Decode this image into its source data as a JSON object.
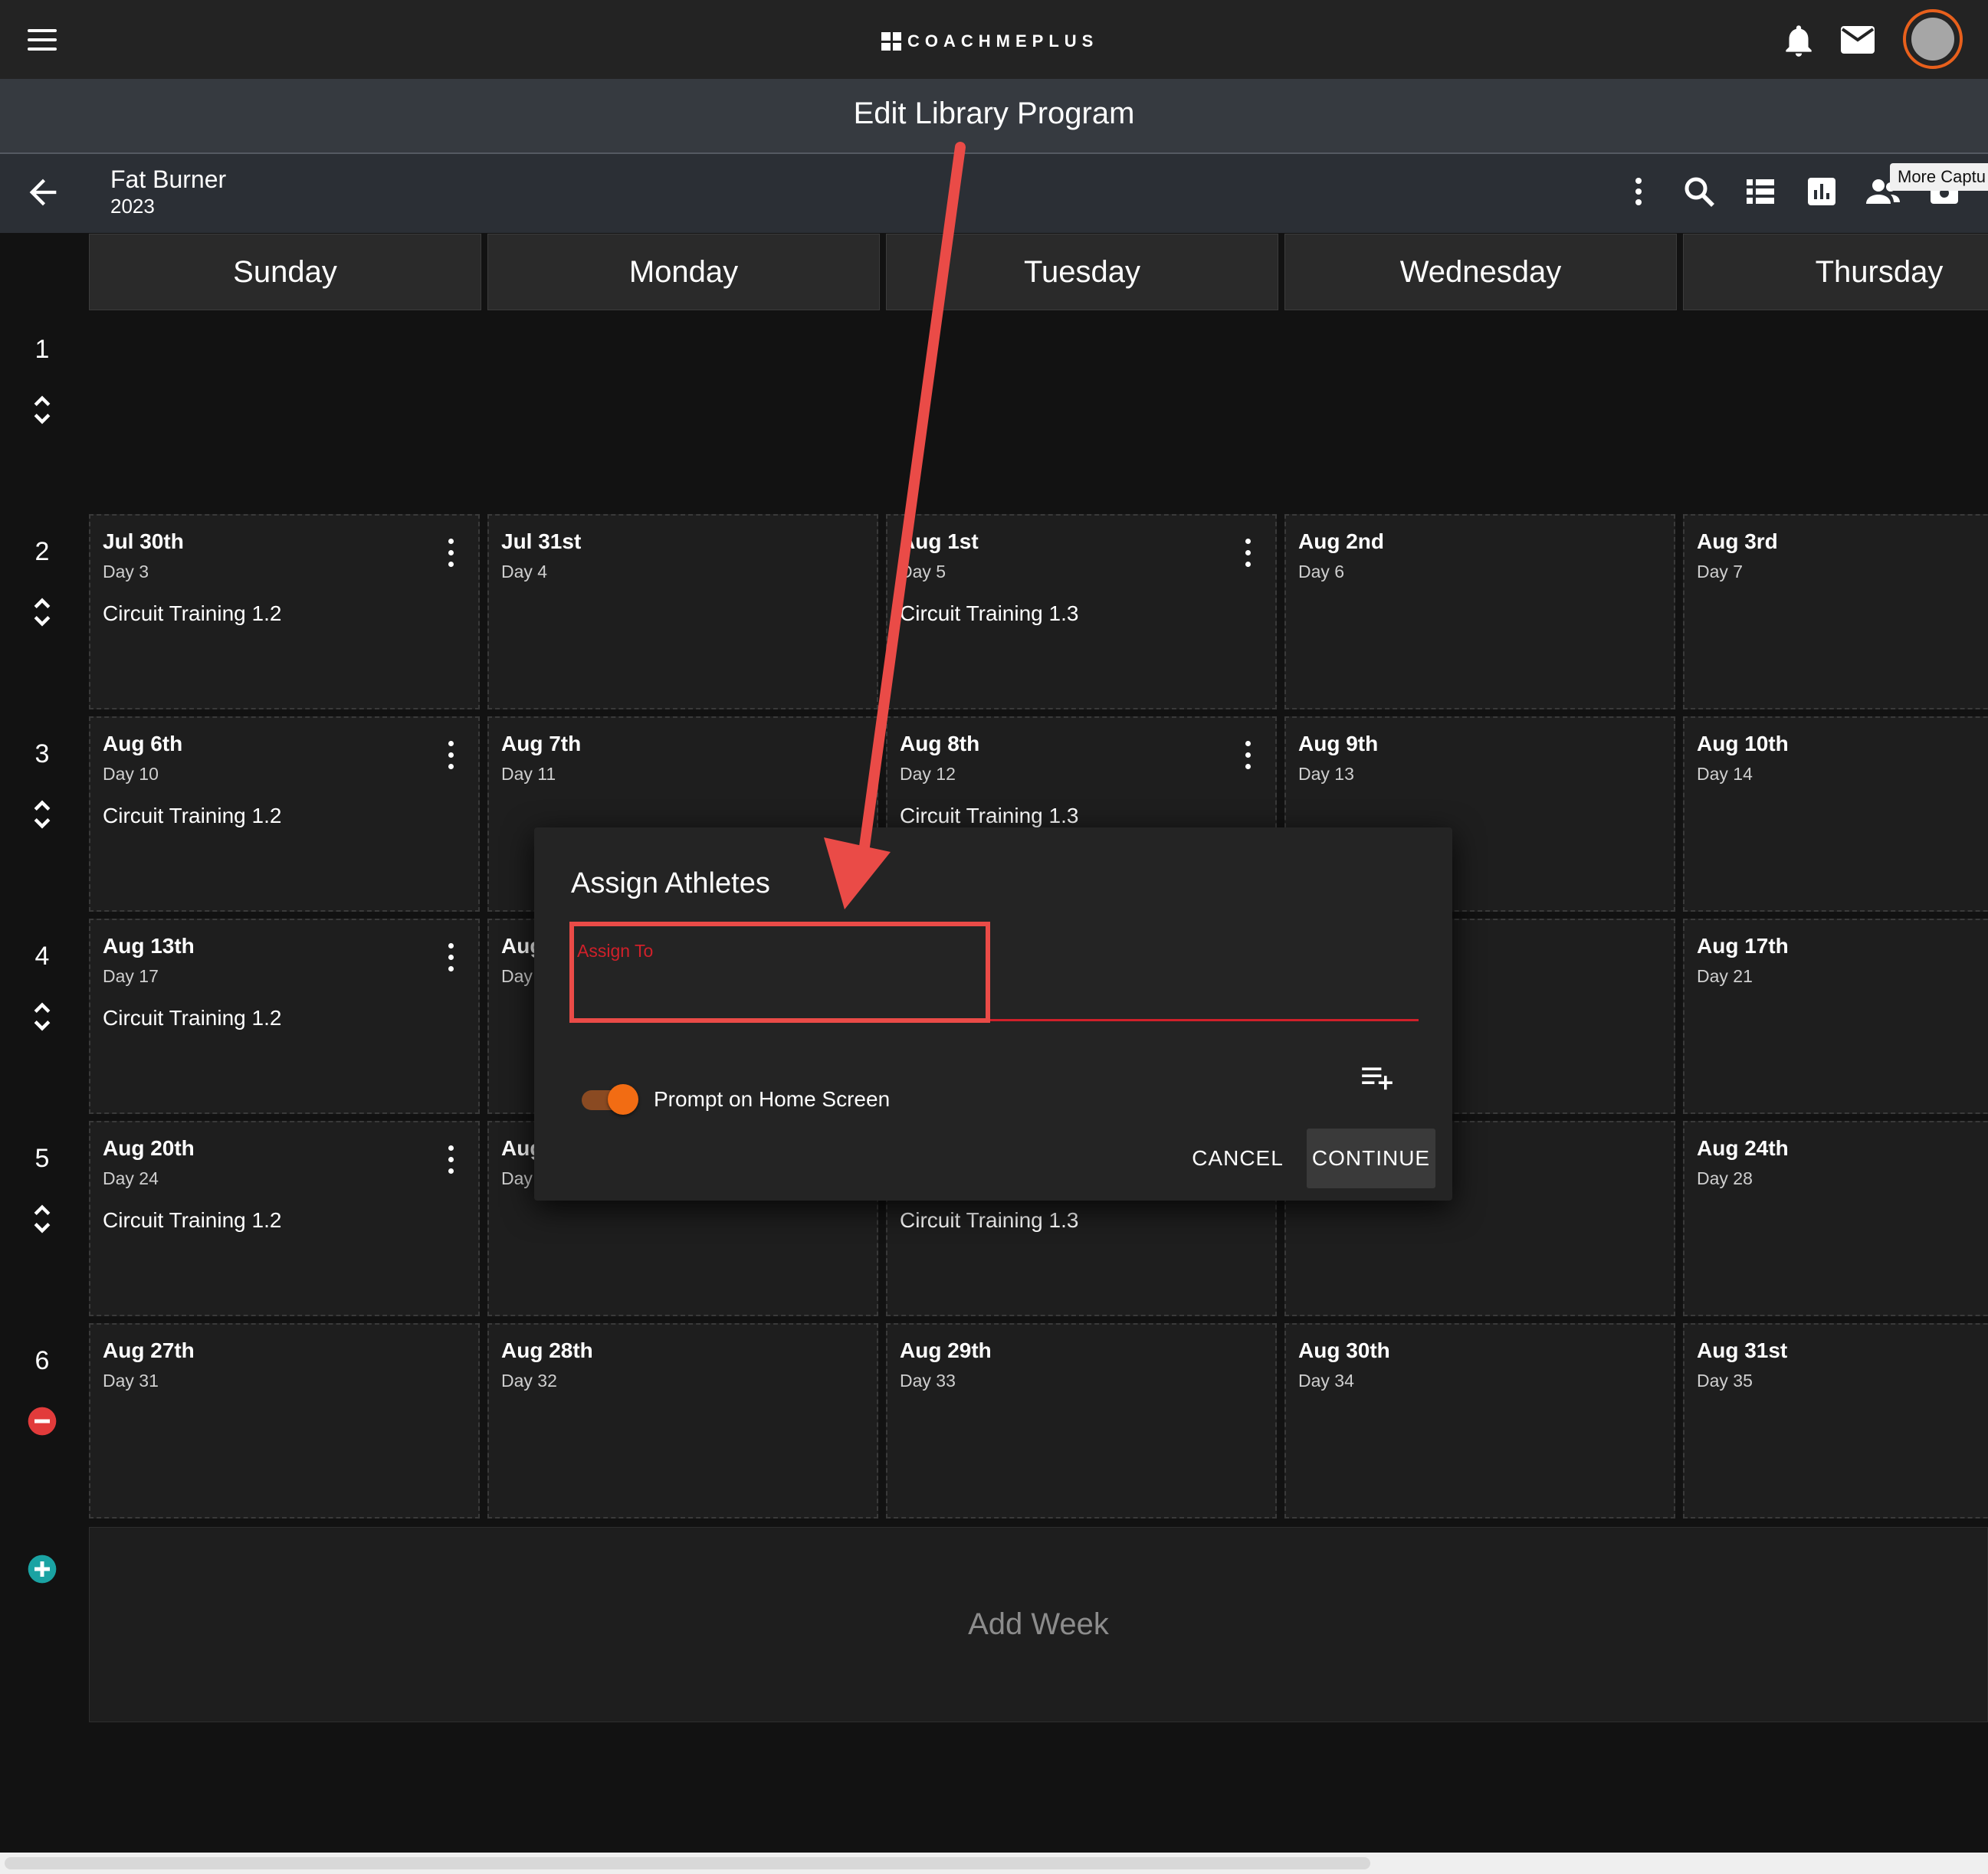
{
  "header": {
    "brand": "COACHMEPLUS",
    "page_title": "Edit Library Program"
  },
  "program": {
    "name": "Fat Burner",
    "year": "2023"
  },
  "toolbar": {
    "tooltip": "More Captu"
  },
  "days": [
    "Sunday",
    "Monday",
    "Tuesday",
    "Wednesday",
    "Thursday"
  ],
  "weeks": [
    {
      "number": "1",
      "cells": []
    },
    {
      "number": "2",
      "cells": [
        {
          "date": "Jul 30th",
          "day": "Day 3",
          "workout": "Circuit Training 1.2",
          "menu": true
        },
        {
          "date": "Jul 31st",
          "day": "Day 4",
          "workout": "",
          "menu": false
        },
        {
          "date": "Aug 1st",
          "day": "Day 5",
          "workout": "Circuit Training 1.3",
          "menu": true
        },
        {
          "date": "Aug 2nd",
          "day": "Day 6",
          "workout": "",
          "menu": false
        },
        {
          "date": "Aug 3rd",
          "day": "Day 7",
          "workout": "",
          "menu": false
        }
      ]
    },
    {
      "number": "3",
      "cells": [
        {
          "date": "Aug 6th",
          "day": "Day 10",
          "workout": "Circuit Training 1.2",
          "menu": true
        },
        {
          "date": "Aug 7th",
          "day": "Day 11",
          "workout": "",
          "menu": false
        },
        {
          "date": "Aug 8th",
          "day": "Day 12",
          "workout": "Circuit Training 1.3",
          "menu": true
        },
        {
          "date": "Aug 9th",
          "day": "Day 13",
          "workout": "",
          "menu": false
        },
        {
          "date": "Aug 10th",
          "day": "Day 14",
          "workout": "",
          "menu": false
        }
      ]
    },
    {
      "number": "4",
      "cells": [
        {
          "date": "Aug 13th",
          "day": "Day 17",
          "workout": "Circuit Training 1.2",
          "menu": true
        },
        {
          "date": "Aug",
          "day": "Day",
          "workout": "",
          "menu": false
        },
        {
          "date": "",
          "day": "",
          "workout": "",
          "menu": false
        },
        {
          "date": "",
          "day": "",
          "workout": "",
          "menu": false
        },
        {
          "date": "Aug 17th",
          "day": "Day 21",
          "workout": "",
          "menu": false
        }
      ]
    },
    {
      "number": "5",
      "cells": [
        {
          "date": "Aug 20th",
          "day": "Day 24",
          "workout": "Circuit Training 1.2",
          "menu": true
        },
        {
          "date": "Aug",
          "day": "Day",
          "workout": "",
          "menu": false
        },
        {
          "date": "",
          "day": "",
          "workout": "Circuit Training 1.3",
          "menu": false
        },
        {
          "date": "",
          "day": "",
          "workout": "",
          "menu": false
        },
        {
          "date": "Aug 24th",
          "day": "Day 28",
          "workout": "",
          "menu": false
        }
      ]
    },
    {
      "number": "6",
      "cells": [
        {
          "date": "Aug 27th",
          "day": "Day 31",
          "workout": "",
          "menu": false
        },
        {
          "date": "Aug 28th",
          "day": "Day 32",
          "workout": "",
          "menu": false
        },
        {
          "date": "Aug 29th",
          "day": "Day 33",
          "workout": "",
          "menu": false
        },
        {
          "date": "Aug 30th",
          "day": "Day 34",
          "workout": "",
          "menu": false
        },
        {
          "date": "Aug 31st",
          "day": "Day 35",
          "workout": "",
          "menu": false
        }
      ]
    }
  ],
  "add_week_label": "Add Week",
  "dialog": {
    "title": "Assign Athletes",
    "field_label": "Assign To",
    "toggle_label": "Prompt on Home Screen",
    "toggle_on": true,
    "cancel_label": "CANCEL",
    "continue_label": "CONTINUE"
  },
  "colors": {
    "accent": "#f26c13",
    "error": "#d0202a",
    "annotation": "#ea4b47",
    "add": "#1aa3a3"
  }
}
